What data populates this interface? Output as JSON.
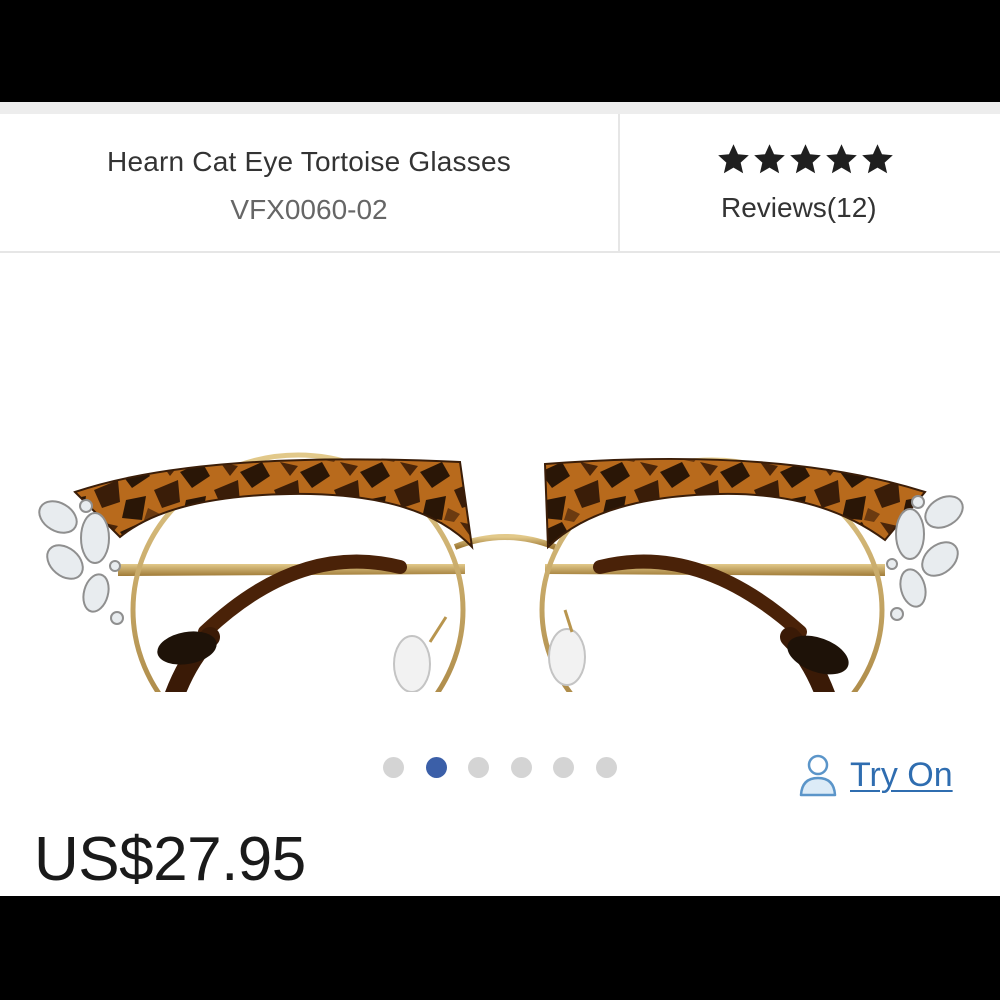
{
  "product": {
    "name": "Hearn Cat Eye Tortoise Glasses",
    "sku": "VFX0060-02",
    "price": "US$27.95"
  },
  "rating": {
    "stars_filled": 5,
    "stars_total": 5,
    "reviews_label": "Reviews(12)"
  },
  "carousel": {
    "total_slides": 6,
    "active_slide": 2
  },
  "try_on": {
    "label": "Try On",
    "icon": "person-icon"
  },
  "colors": {
    "accent_blue": "#2f6db0",
    "active_dot": "#3b5fa8",
    "inactive_dot": "#d4d4d4",
    "tortoise_dark": "#2a1606",
    "tortoise_light": "#b86a1c",
    "frame_gold": "#b8954e"
  }
}
